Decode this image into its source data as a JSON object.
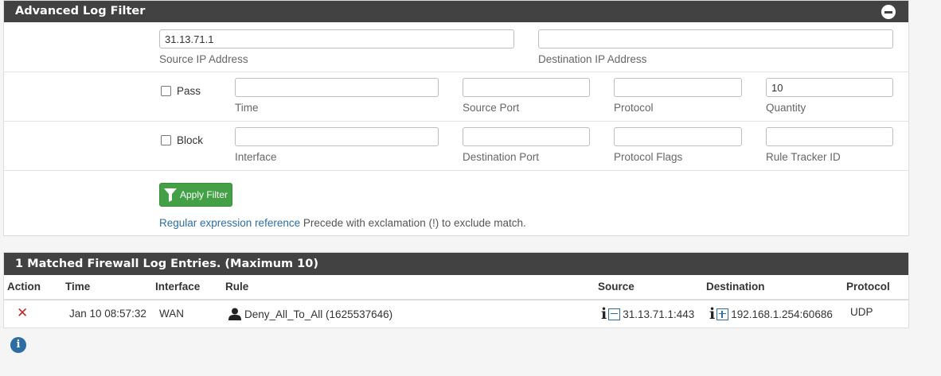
{
  "filter_panel": {
    "title": "Advanced Log Filter",
    "source_ip": {
      "value": "31.13.71.1",
      "label": "Source IP Address"
    },
    "destination_ip": {
      "value": "",
      "label": "Destination IP Address"
    },
    "pass_label": "Pass",
    "block_label": "Block",
    "time": {
      "value": "",
      "label": "Time"
    },
    "source_port": {
      "value": "",
      "label": "Source Port"
    },
    "protocol": {
      "value": "",
      "label": "Protocol"
    },
    "quantity": {
      "value": "10",
      "label": "Quantity"
    },
    "interface": {
      "value": "",
      "label": "Interface"
    },
    "destination_port": {
      "value": "",
      "label": "Destination Port"
    },
    "protocol_flags": {
      "value": "",
      "label": "Protocol Flags"
    },
    "rule_tracker_id": {
      "value": "",
      "label": "Rule Tracker ID"
    },
    "apply_label": "Apply Filter",
    "regex_link": "Regular expression reference",
    "regex_hint": "Precede with exclamation (!) to exclude match."
  },
  "results_panel": {
    "title": "1 Matched Firewall Log Entries. (Maximum 10)",
    "columns": {
      "action": "Action",
      "time": "Time",
      "interface": "Interface",
      "rule": "Rule",
      "source": "Source",
      "destination": "Destination",
      "protocol": "Protocol"
    },
    "rows": [
      {
        "action_icon": "close-icon",
        "time": "Jan 10 08:57:32",
        "interface": "WAN",
        "rule": "Deny_All_To_All (1625537646)",
        "source": "31.13.71.1:443",
        "destination": "192.168.1.254:60686",
        "protocol": "UDP"
      }
    ]
  },
  "colors": {
    "header_bg": "#424242",
    "apply_button": "#43a047",
    "link": "#2c6da4",
    "block_action": "#c62828"
  }
}
